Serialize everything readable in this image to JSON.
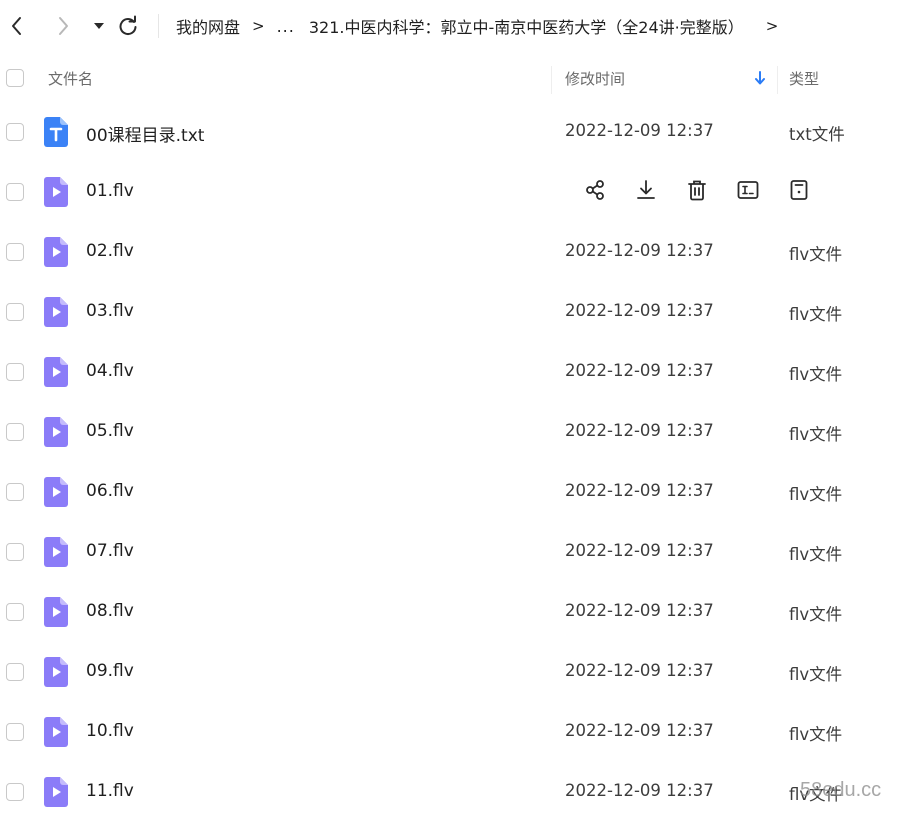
{
  "nav": {
    "back_icon": "chevron-left-icon",
    "forward_icon": "chevron-right-icon",
    "history_icon": "caret-down-icon",
    "refresh_icon": "refresh-icon"
  },
  "breadcrumb": {
    "root": "我的网盘",
    "separator": ">",
    "ellipsis": "...",
    "current": "321.中医内科学：郭立中-南京中医药大学（全24讲·完整版）",
    "trailing_separator": ">"
  },
  "header": {
    "name_label": "文件名",
    "time_label": "修改时间",
    "sort_icon": "arrow-down-icon",
    "sort_color": "#2b7cf6",
    "type_label": "类型"
  },
  "actions": {
    "share_icon": "share-icon",
    "download_icon": "download-icon",
    "delete_icon": "trash-icon",
    "rename_icon": "rename-icon",
    "more_icon": "details-icon"
  },
  "colors": {
    "txt_icon": "#3b82f6",
    "video_icon": "#7b6ef6"
  },
  "files": [
    {
      "name": "00课程目录.txt",
      "time": "2022-12-09 12:37",
      "type": "txt文件",
      "icon": "text-file-icon",
      "hovered": false
    },
    {
      "name": "01.flv",
      "time": "",
      "type": "",
      "icon": "video-file-icon",
      "hovered": true
    },
    {
      "name": "02.flv",
      "time": "2022-12-09 12:37",
      "type": "flv文件",
      "icon": "video-file-icon",
      "hovered": false
    },
    {
      "name": "03.flv",
      "time": "2022-12-09 12:37",
      "type": "flv文件",
      "icon": "video-file-icon",
      "hovered": false
    },
    {
      "name": "04.flv",
      "time": "2022-12-09 12:37",
      "type": "flv文件",
      "icon": "video-file-icon",
      "hovered": false
    },
    {
      "name": "05.flv",
      "time": "2022-12-09 12:37",
      "type": "flv文件",
      "icon": "video-file-icon",
      "hovered": false
    },
    {
      "name": "06.flv",
      "time": "2022-12-09 12:37",
      "type": "flv文件",
      "icon": "video-file-icon",
      "hovered": false
    },
    {
      "name": "07.flv",
      "time": "2022-12-09 12:37",
      "type": "flv文件",
      "icon": "video-file-icon",
      "hovered": false
    },
    {
      "name": "08.flv",
      "time": "2022-12-09 12:37",
      "type": "flv文件",
      "icon": "video-file-icon",
      "hovered": false
    },
    {
      "name": "09.flv",
      "time": "2022-12-09 12:37",
      "type": "flv文件",
      "icon": "video-file-icon",
      "hovered": false
    },
    {
      "name": "10.flv",
      "time": "2022-12-09 12:37",
      "type": "flv文件",
      "icon": "video-file-icon",
      "hovered": false
    },
    {
      "name": "11.flv",
      "time": "2022-12-09 12:37",
      "type": "flv文件",
      "icon": "video-file-icon",
      "hovered": false
    }
  ],
  "watermark": "58edu.cc"
}
